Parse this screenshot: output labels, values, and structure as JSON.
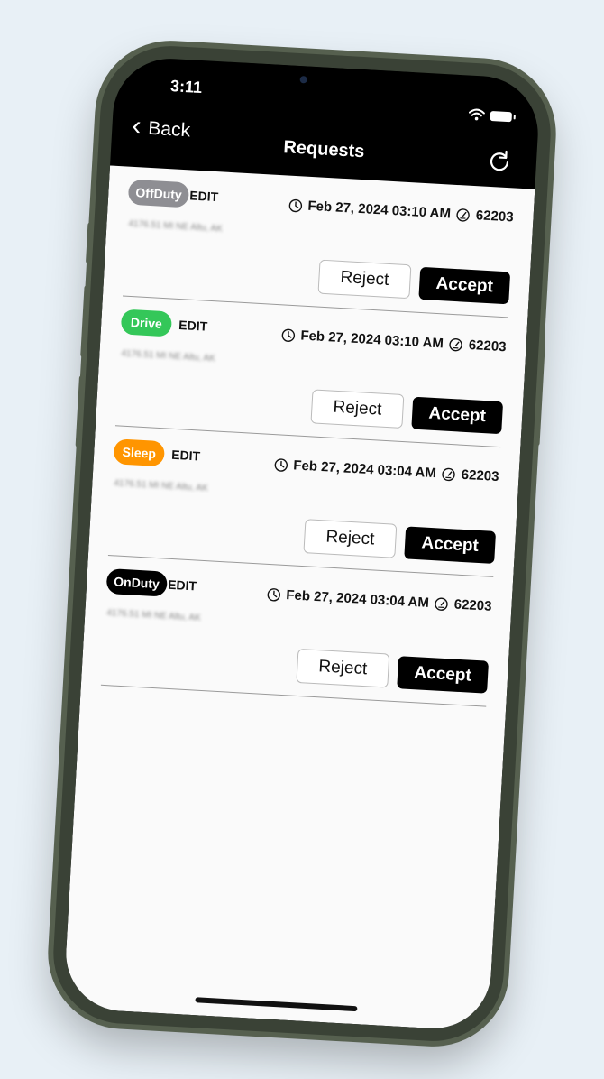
{
  "status_bar": {
    "time": "3:11",
    "icons": [
      "wifi-icon",
      "battery-icon"
    ]
  },
  "nav": {
    "back_label": "Back",
    "title": "Requests",
    "refresh_icon": "refresh-icon"
  },
  "requests": [
    {
      "status": "OffDuty",
      "status_color": "#8e8e93",
      "edit_label": "EDIT",
      "datetime": "Feb 27, 2024 03:10 AM",
      "odometer": "62203",
      "location": "4176.51 MI NE Altu, AK",
      "reject_label": "Reject",
      "accept_label": "Accept"
    },
    {
      "status": "Drive",
      "status_color": "#34c759",
      "edit_label": "EDIT",
      "datetime": "Feb 27, 2024 03:10 AM",
      "odometer": "62203",
      "location": "4176.51 MI NE Altu, AK",
      "reject_label": "Reject",
      "accept_label": "Accept"
    },
    {
      "status": "Sleep",
      "status_color": "#ff9500",
      "edit_label": "EDIT",
      "datetime": "Feb 27, 2024 03:04 AM",
      "odometer": "62203",
      "location": "4176.51 MI NE Altu, AK",
      "reject_label": "Reject",
      "accept_label": "Accept"
    },
    {
      "status": "OnDuty",
      "status_color": "#000000",
      "edit_label": "EDIT",
      "datetime": "Feb 27, 2024 03:04 AM",
      "odometer": "62203",
      "location": "4176.51 MI NE Altu, AK",
      "reject_label": "Reject",
      "accept_label": "Accept"
    }
  ]
}
